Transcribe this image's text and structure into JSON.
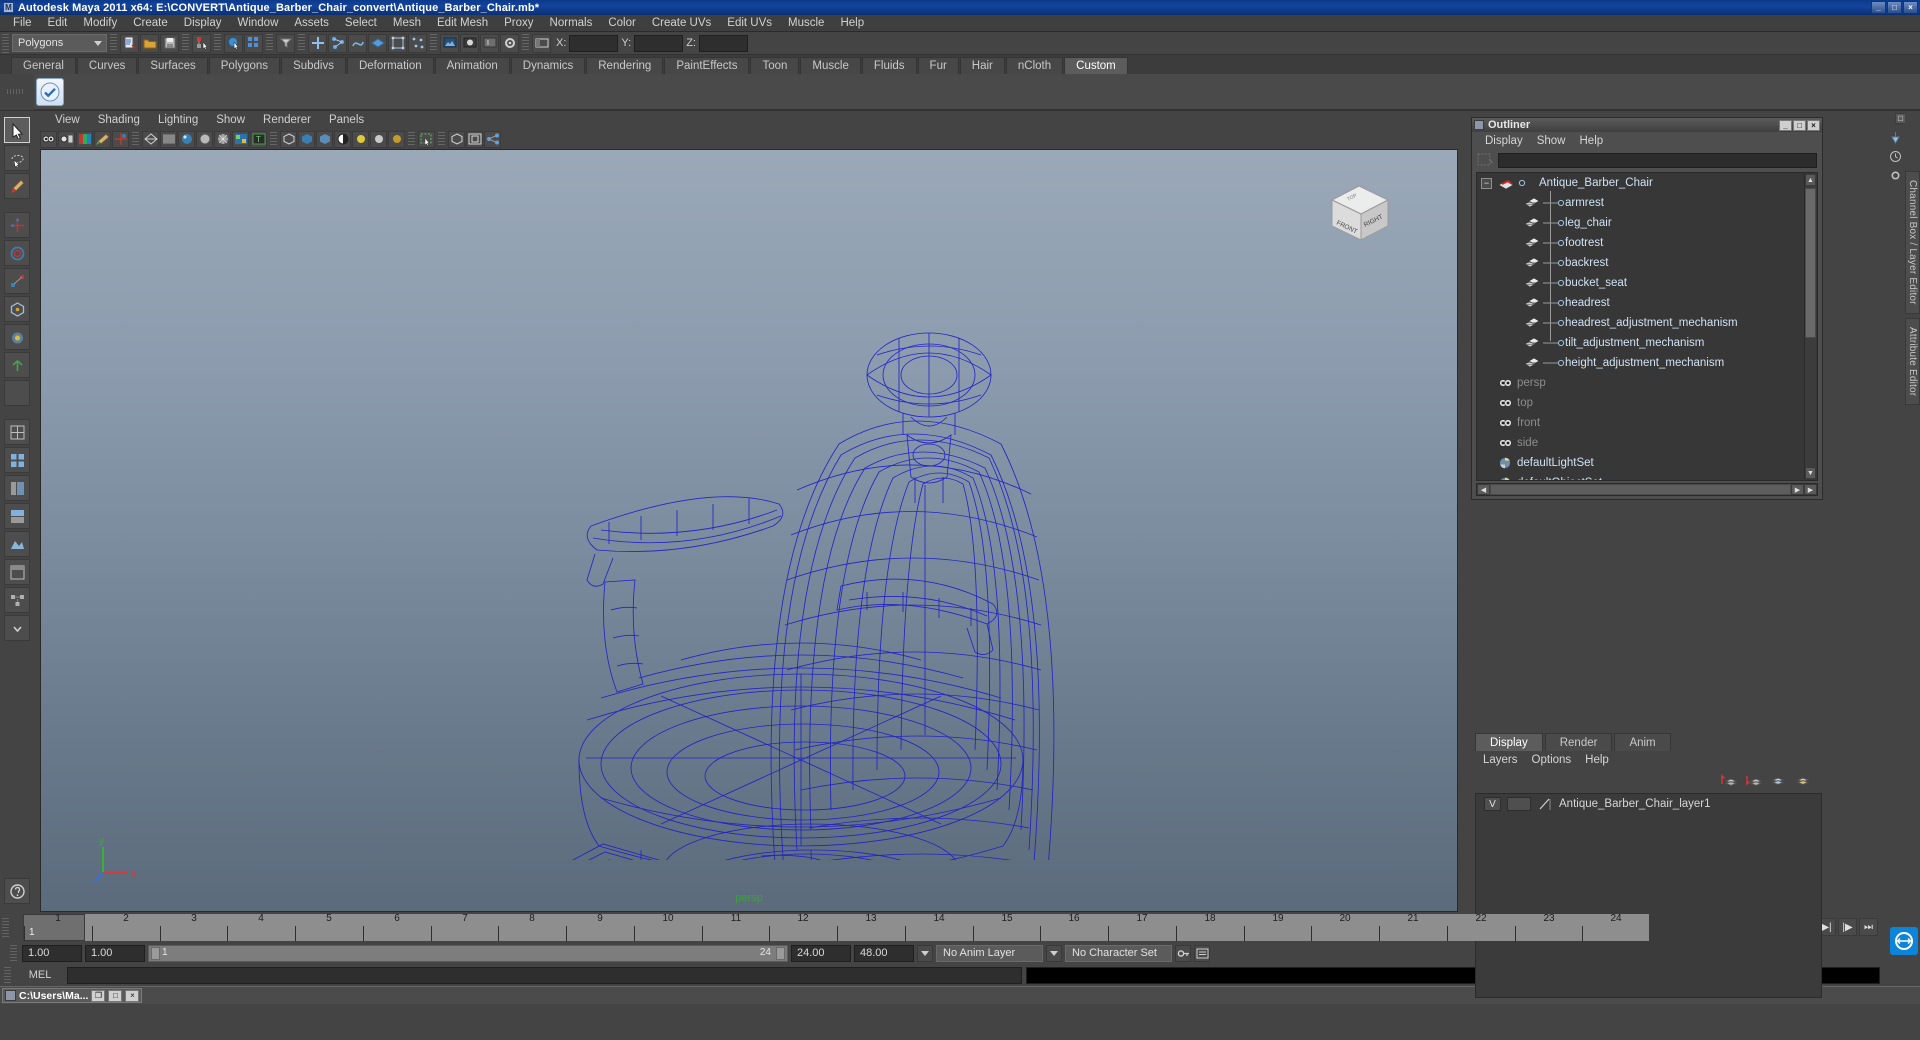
{
  "window": {
    "title": "Autodesk Maya 2011 x64: E:\\CONVERT\\Antique_Barber_Chair_convert\\Antique_Barber_Chair.mb*",
    "icon": "maya-icon",
    "minimize": "_",
    "maximize": "□",
    "close": "×"
  },
  "menubar": {
    "items": [
      {
        "label": "File"
      },
      {
        "label": "Edit"
      },
      {
        "label": "Modify"
      },
      {
        "label": "Create"
      },
      {
        "label": "Display"
      },
      {
        "label": "Window"
      },
      {
        "label": "Assets"
      },
      {
        "label": "Select"
      },
      {
        "label": "Mesh"
      },
      {
        "label": "Edit Mesh"
      },
      {
        "label": "Proxy"
      },
      {
        "label": "Normals"
      },
      {
        "label": "Color"
      },
      {
        "label": "Create UVs"
      },
      {
        "label": "Edit UVs"
      },
      {
        "label": "Muscle"
      },
      {
        "label": "Help"
      }
    ]
  },
  "statusline": {
    "menu_set": "Polygons",
    "coords": [
      {
        "label": "X:",
        "value": ""
      },
      {
        "label": "Y:",
        "value": ""
      },
      {
        "label": "Z:",
        "value": ""
      }
    ]
  },
  "shelf": {
    "tabs": [
      {
        "label": "General",
        "active": false
      },
      {
        "label": "Curves",
        "active": false
      },
      {
        "label": "Surfaces",
        "active": false
      },
      {
        "label": "Polygons",
        "active": false
      },
      {
        "label": "Subdivs",
        "active": false
      },
      {
        "label": "Deformation",
        "active": false
      },
      {
        "label": "Animation",
        "active": false
      },
      {
        "label": "Dynamics",
        "active": false
      },
      {
        "label": "Rendering",
        "active": false
      },
      {
        "label": "PaintEffects",
        "active": false
      },
      {
        "label": "Toon",
        "active": false
      },
      {
        "label": "Muscle",
        "active": false
      },
      {
        "label": "Fluids",
        "active": false
      },
      {
        "label": "Fur",
        "active": false
      },
      {
        "label": "Hair",
        "active": false
      },
      {
        "label": "nCloth",
        "active": false
      },
      {
        "label": "Custom",
        "active": true
      }
    ]
  },
  "viewport": {
    "menus": [
      {
        "label": "View"
      },
      {
        "label": "Shading"
      },
      {
        "label": "Lighting"
      },
      {
        "label": "Show"
      },
      {
        "label": "Renderer"
      },
      {
        "label": "Panels"
      }
    ],
    "camera_label": "persp",
    "axis": {
      "x": "x",
      "y": "y",
      "z": "z"
    },
    "viewcube": {
      "front": "FRONT",
      "right": "RIGHT",
      "top": "TOP"
    },
    "wireframe_color": "#2020c8"
  },
  "outliner": {
    "title": "Outliner",
    "menus": [
      {
        "label": "Display"
      },
      {
        "label": "Show"
      },
      {
        "label": "Help"
      }
    ],
    "search_value": "",
    "tree": [
      {
        "label": "Antique_Barber_Chair",
        "type": "group",
        "depth": 0,
        "expanded": true,
        "dim": false
      },
      {
        "label": "armrest",
        "type": "mesh",
        "depth": 1,
        "dim": false
      },
      {
        "label": "leg_chair",
        "type": "mesh",
        "depth": 1,
        "dim": false
      },
      {
        "label": "footrest",
        "type": "mesh",
        "depth": 1,
        "dim": false
      },
      {
        "label": "backrest",
        "type": "mesh",
        "depth": 1,
        "dim": false
      },
      {
        "label": "bucket_seat",
        "type": "mesh",
        "depth": 1,
        "dim": false
      },
      {
        "label": "headrest",
        "type": "mesh",
        "depth": 1,
        "dim": false
      },
      {
        "label": "headrest_adjustment_mechanism",
        "type": "mesh",
        "depth": 1,
        "dim": false
      },
      {
        "label": "tilt_adjustment_mechanism",
        "type": "mesh",
        "depth": 1,
        "dim": false
      },
      {
        "label": "height_adjustment_mechanism",
        "type": "mesh",
        "depth": 1,
        "dim": false
      },
      {
        "label": "persp",
        "type": "camera",
        "depth": 0,
        "dim": true
      },
      {
        "label": "top",
        "type": "camera",
        "depth": 0,
        "dim": true
      },
      {
        "label": "front",
        "type": "camera",
        "depth": 0,
        "dim": true
      },
      {
        "label": "side",
        "type": "camera",
        "depth": 0,
        "dim": true
      },
      {
        "label": "defaultLightSet",
        "type": "set",
        "depth": 0,
        "dim": false
      },
      {
        "label": "defaultObjectSet",
        "type": "set",
        "depth": 0,
        "dim": false
      }
    ],
    "buttons": {
      "minimize": "_",
      "maximize": "□",
      "close": "×"
    }
  },
  "layer_editor": {
    "tabs": [
      {
        "label": "Display",
        "active": true
      },
      {
        "label": "Render",
        "active": false
      },
      {
        "label": "Anim",
        "active": false
      }
    ],
    "menus": [
      {
        "label": "Layers"
      },
      {
        "label": "Options"
      },
      {
        "label": "Help"
      }
    ],
    "layers": [
      {
        "visibility": "V",
        "display_type": "",
        "name": "Antique_Barber_Chair_layer1"
      }
    ]
  },
  "right_tabs": [
    {
      "label": "Channel Box / Layer Editor"
    },
    {
      "label": "Attribute Editor"
    }
  ],
  "time_slider": {
    "start_tick": 1,
    "end_tick": 24,
    "current_frame": "1",
    "ticks": [
      1,
      2,
      3,
      4,
      5,
      6,
      7,
      8,
      9,
      10,
      11,
      12,
      13,
      14,
      15,
      16,
      17,
      18,
      19,
      20,
      21,
      22,
      23,
      24
    ],
    "current_time_field": "1.00",
    "playback_buttons": [
      {
        "name": "go-to-start",
        "glyph": "⏮"
      },
      {
        "name": "step-back-frame",
        "glyph": "◀|"
      },
      {
        "name": "step-back-key",
        "glyph": "|◀"
      },
      {
        "name": "play-backwards",
        "glyph": "◀"
      },
      {
        "name": "play-forwards",
        "glyph": "▶"
      },
      {
        "name": "step-forward-key",
        "glyph": "▶|"
      },
      {
        "name": "step-forward-frame",
        "glyph": "|▶"
      },
      {
        "name": "go-to-end",
        "glyph": "⏭"
      }
    ]
  },
  "range_slider": {
    "anim_start": "1.00",
    "range_start": "1.00",
    "range_bar_start": "1",
    "range_bar_end": "24",
    "range_end": "24.00",
    "anim_end": "48.00",
    "anim_layer": "No Anim Layer",
    "character_set": "No Character Set"
  },
  "command_line": {
    "mode_label": "MEL",
    "input_value": "",
    "output_value": ""
  },
  "taskbar": {
    "items": [
      {
        "title": "C:\\Users\\Ma...",
        "icon": "maya-icon",
        "restore": "❐",
        "maximize": "□",
        "close": "×"
      }
    ]
  },
  "colors": {
    "title_blue": "#0b3a8c",
    "panel_gray": "#444444",
    "wire_blue": "#2020c8",
    "outliner_text": "#cfe2f4",
    "accent_green": "#3ba13b"
  }
}
